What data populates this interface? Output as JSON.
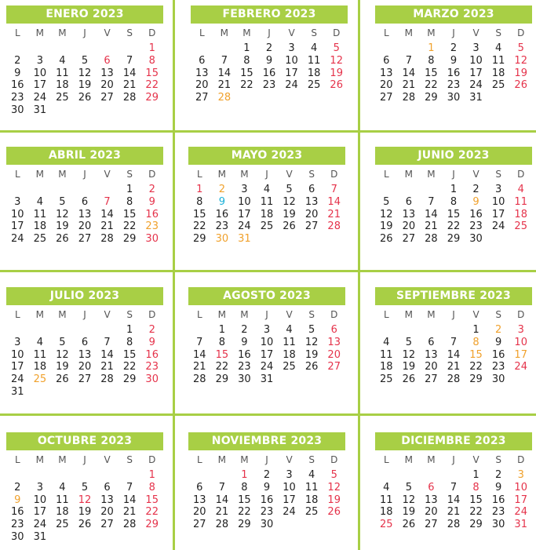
{
  "weekdays": [
    "L",
    "M",
    "M",
    "J",
    "V",
    "S",
    "D"
  ],
  "colors": {
    "green": "#a8cf45",
    "red": "#e5334b",
    "orange": "#f0a12c",
    "blue": "#1ab0d8"
  },
  "months": [
    {
      "name": "ENERO 2023",
      "offset": 6,
      "days": 31,
      "red": [
        1,
        8,
        15,
        22,
        29,
        6
      ],
      "orange": [],
      "blue": []
    },
    {
      "name": "FEBRERO 2023",
      "offset": 2,
      "days": 28,
      "red": [
        5,
        12,
        19,
        26
      ],
      "orange": [
        28
      ],
      "blue": []
    },
    {
      "name": "MARZO 2023",
      "offset": 2,
      "days": 31,
      "red": [
        5,
        12,
        19,
        26
      ],
      "orange": [
        1
      ],
      "blue": []
    },
    {
      "name": "ABRIL 2023",
      "offset": 5,
      "days": 30,
      "red": [
        2,
        9,
        16,
        30,
        7
      ],
      "orange": [
        23
      ],
      "blue": []
    },
    {
      "name": "MAYO 2023",
      "offset": 0,
      "days": 31,
      "red": [
        7,
        14,
        21,
        28,
        1
      ],
      "orange": [
        2,
        30,
        31
      ],
      "blue": [
        9
      ]
    },
    {
      "name": "JUNIO 2023",
      "offset": 3,
      "days": 30,
      "red": [
        4,
        11,
        18,
        25
      ],
      "orange": [
        9
      ],
      "blue": []
    },
    {
      "name": "JULIO 2023",
      "offset": 5,
      "days": 31,
      "red": [
        2,
        9,
        16,
        23,
        30
      ],
      "orange": [
        25
      ],
      "blue": []
    },
    {
      "name": "AGOSTO 2023",
      "offset": 1,
      "days": 31,
      "red": [
        6,
        13,
        20,
        27,
        15
      ],
      "orange": [],
      "blue": []
    },
    {
      "name": "SEPTIEMBRE 2023",
      "offset": 4,
      "days": 30,
      "red": [
        3,
        10,
        24
      ],
      "orange": [
        2,
        8,
        15,
        17
      ],
      "blue": []
    },
    {
      "name": "OCTUBRE 2023",
      "offset": 6,
      "days": 31,
      "red": [
        1,
        8,
        15,
        22,
        29,
        12
      ],
      "orange": [
        9
      ],
      "blue": []
    },
    {
      "name": "NOVIEMBRE 2023",
      "offset": 2,
      "days": 30,
      "red": [
        5,
        12,
        19,
        26,
        1
      ],
      "orange": [],
      "blue": []
    },
    {
      "name": "DICIEMBRE 2023",
      "offset": 4,
      "days": 31,
      "red": [
        10,
        17,
        24,
        31,
        6,
        8,
        25
      ],
      "orange": [
        3
      ],
      "blue": []
    }
  ]
}
